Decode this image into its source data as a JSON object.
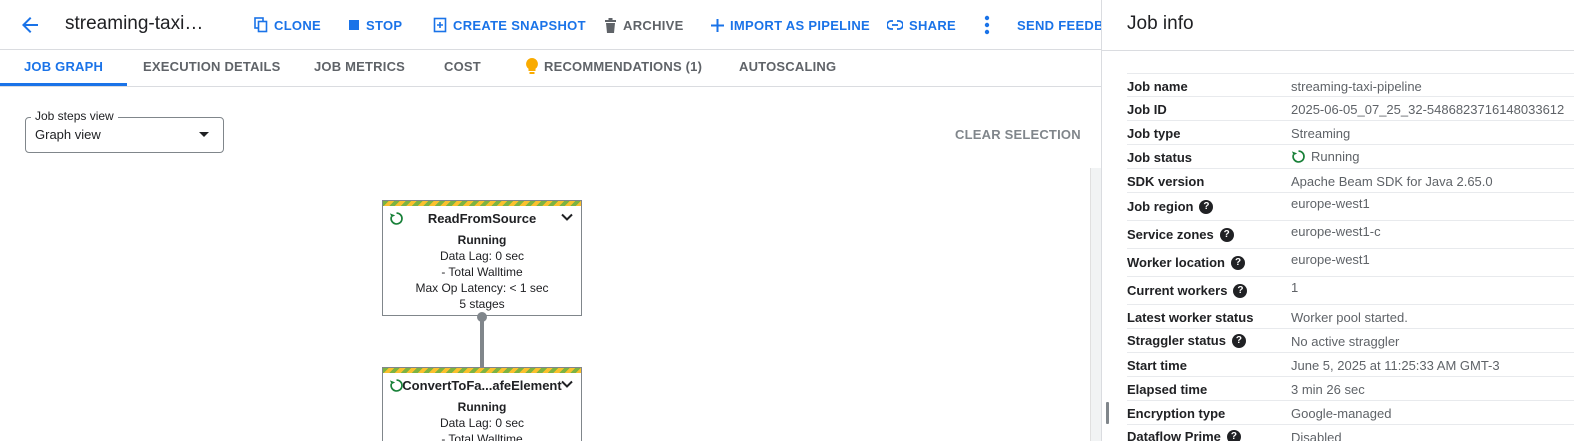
{
  "header": {
    "title": "streaming-taxi…",
    "buttons": {
      "clone": "CLONE",
      "stop": "STOP",
      "snapshot": "CREATE SNAPSHOT",
      "archive": "ARCHIVE",
      "import": "IMPORT AS PIPELINE",
      "share": "SHARE",
      "feedback": "SEND FEEDBA"
    }
  },
  "tabs": [
    "JOB GRAPH",
    "EXECUTION DETAILS",
    "JOB METRICS",
    "COST",
    "RECOMMENDATIONS (1)",
    "AUTOSCALING"
  ],
  "steps_view": {
    "legend": "Job steps view",
    "value": "Graph view"
  },
  "clear_selection": "CLEAR SELECTION",
  "graph": {
    "nodes": [
      {
        "name": "ReadFromSource",
        "status": "Running",
        "lines": [
          "Data Lag: 0 sec",
          "- Total Walltime",
          "Max Op Latency: < 1 sec",
          "5 stages"
        ]
      },
      {
        "name": "ConvertToFa...afeElement",
        "status": "Running",
        "lines": [
          "Data Lag: 0 sec",
          "- Total Walltime"
        ]
      }
    ]
  },
  "job_info": {
    "title": "Job info",
    "rows": [
      {
        "key": "Job name",
        "value": "streaming-taxi-pipeline"
      },
      {
        "key": "Job ID",
        "value": "2025-06-05_07_25_32-5486823716148033612"
      },
      {
        "key": "Job type",
        "value": "Streaming"
      },
      {
        "key": "Job status",
        "value": "Running"
      },
      {
        "key": "SDK version",
        "value": "Apache Beam SDK for Java 2.65.0"
      },
      {
        "key": "Job region",
        "value": "europe-west1"
      },
      {
        "key": "Service zones",
        "value": "europe-west1-c"
      },
      {
        "key": "Worker location",
        "value": "europe-west1"
      },
      {
        "key": "Current workers",
        "value": "1"
      },
      {
        "key": "Latest worker status",
        "value": "Worker pool started."
      },
      {
        "key": "Straggler status",
        "value": "No active straggler"
      },
      {
        "key": "Start time",
        "value": "June 5, 2025 at 11:25:33 AM GMT-3"
      },
      {
        "key": "Elapsed time",
        "value": "3 min 26 sec"
      },
      {
        "key": "Encryption type",
        "value": "Google-managed"
      },
      {
        "key": "Dataflow Prime",
        "value": "Disabled"
      }
    ]
  },
  "colors": {
    "accent": "#1a73e8",
    "running": "#188038",
    "text": "#202124",
    "muted": "#5f6368"
  }
}
